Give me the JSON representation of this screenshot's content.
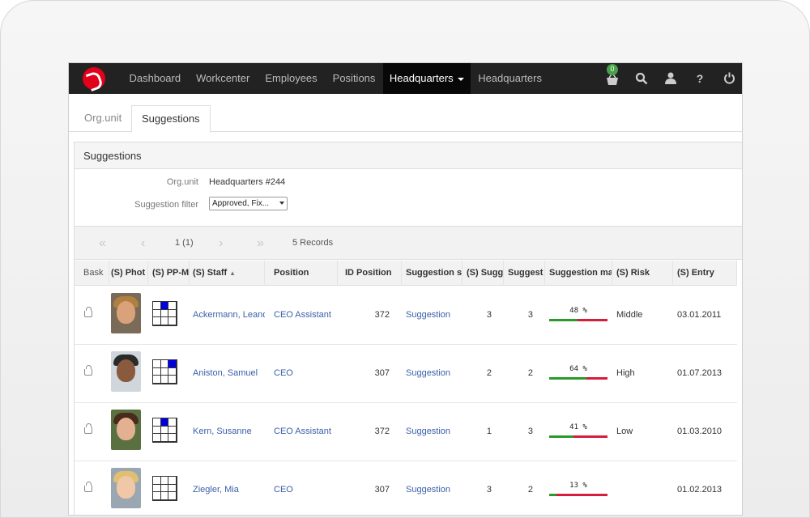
{
  "navbar": {
    "items": [
      "Dashboard",
      "Workcenter",
      "Employees",
      "Positions"
    ],
    "active_item": "Headquarters",
    "trailing_item": "Headquarters",
    "basket_count": "0",
    "icons": [
      "basket-icon",
      "search-icon",
      "user-icon",
      "help-icon",
      "power-icon"
    ]
  },
  "tabs": [
    "Org.unit",
    "Suggestions"
  ],
  "panel": {
    "title": "Suggestions",
    "orgunit_label": "Org.unit",
    "orgunit_value": "Headquarters #244",
    "filter_label": "Suggestion filter",
    "filter_value": "Approved, Fix..."
  },
  "pager": {
    "page": "1 (1)",
    "records": "5 Records"
  },
  "columns": [
    "Bask",
    "(S) Phot",
    "(S) PP-M",
    "(S) Staff",
    "Position",
    "ID Position",
    "Suggestion s",
    "(S) Sugg",
    "Suggest",
    "Suggestion ma",
    "(S) Risk",
    "(S) Entry"
  ],
  "rows": [
    {
      "staff": "Ackermann, Leand",
      "position": "CEO Assistant",
      "id_position": "372",
      "suggestion": "Suggestion",
      "s_sugg": "3",
      "suggest": "3",
      "match_label": "48 %",
      "match": 0.48,
      "risk": "Middle",
      "entry": "03.01.2011",
      "pp_cell": 1
    },
    {
      "staff": "Aniston, Samuel",
      "position": "CEO",
      "id_position": "307",
      "suggestion": "Suggestion",
      "s_sugg": "2",
      "suggest": "2",
      "match_label": "64 %",
      "match": 0.64,
      "risk": "High",
      "entry": "01.07.2013",
      "pp_cell": 2
    },
    {
      "staff": "Kern, Susanne",
      "position": "CEO Assistant",
      "id_position": "372",
      "suggestion": "Suggestion",
      "s_sugg": "1",
      "suggest": "3",
      "match_label": "41 %",
      "match": 0.41,
      "risk": "Low",
      "entry": "01.03.2010",
      "pp_cell": 1
    },
    {
      "staff": "Ziegler, Mia",
      "position": "CEO",
      "id_position": "307",
      "suggestion": "Suggestion",
      "s_sugg": "3",
      "suggest": "2",
      "match_label": "13 %",
      "match": 0.13,
      "risk": "",
      "entry": "01.02.2013",
      "pp_cell": -1
    }
  ],
  "colors": {
    "accent": "#e2001a",
    "link": "#3a5fa8",
    "bar_green": "#2a9a2a",
    "bar_red": "#d81c3c",
    "grid_blue": "#0000e0"
  }
}
